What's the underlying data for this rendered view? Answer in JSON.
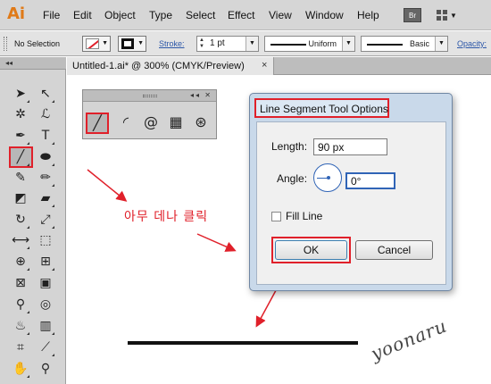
{
  "app": {
    "logo": "Ai"
  },
  "menu": [
    "File",
    "Edit",
    "Object",
    "Type",
    "Select",
    "Effect",
    "View",
    "Window",
    "Help"
  ],
  "menubar_right": {
    "bridge_label": "Br",
    "workspace_icon": "grid-icon"
  },
  "control_bar": {
    "selection_label": "No Selection",
    "stroke_label": "Stroke:",
    "stroke_weight": "1 pt",
    "profile_label": "Uniform",
    "brush_label": "Basic",
    "opacity_label": "Opacity:"
  },
  "tool_panel": {
    "collapse": "◂◂"
  },
  "document": {
    "tab_title": "Untitled-1.ai* @ 300% (CMYK/Preview)",
    "close": "×"
  },
  "line_palette": {
    "buttons": "◂◂ ✕"
  },
  "annotation": {
    "text": "아무 데나 클릭",
    "color": "#e0202a"
  },
  "dialog": {
    "title": "Line Segment Tool Options",
    "length_label": "Length:",
    "length_value": "90 px",
    "angle_label": "Angle:",
    "angle_value": "0°",
    "fill_label": "Fill Line",
    "fill_checked": false,
    "ok_label": "OK",
    "cancel_label": "Cancel"
  },
  "signature": "yoonaru",
  "colors": {
    "accent_red": "#e0202a",
    "dialog_frame": "#c9d9ea",
    "logo_orange": "#e07a18"
  }
}
